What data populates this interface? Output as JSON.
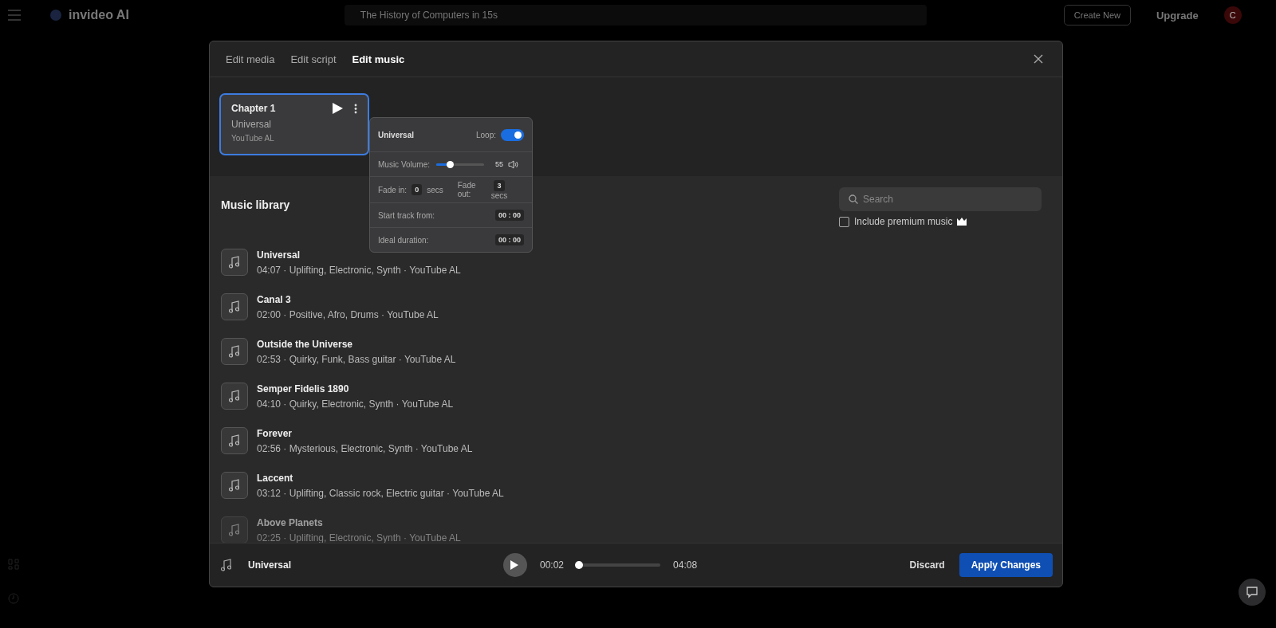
{
  "topbar": {
    "brand": "invideo AI",
    "project_title": "The History of Computers in 15s",
    "create_button": "Create New",
    "upgrade_button": "Upgrade",
    "avatar": "C"
  },
  "modal": {
    "tabs": [
      {
        "label": "Edit media",
        "selected": false
      },
      {
        "label": "Edit script",
        "selected": false
      },
      {
        "label": "Edit music",
        "selected": true
      }
    ],
    "card": {
      "title": "Chapter 1",
      "track": "Universal",
      "source": "YouTube AL",
      "selected": true
    },
    "popover": {
      "track": "Universal",
      "loop_label": "Loop:",
      "loop": true,
      "volume_label": "Music Volume:",
      "volume": {
        "level": 0.3
      },
      "volume_reading": "55",
      "fade_in_label": "Fade in:",
      "fade_in": "0",
      "fade_in_unit": "secs",
      "fade_out_label": "Fade out:",
      "fade_out": "3",
      "fade_out_unit": "secs",
      "start_label": "Start track from:",
      "start": "00 : 00",
      "duration_label": "Ideal duration:",
      "duration": "00 : 00"
    },
    "library": {
      "title": "Music library",
      "search": {
        "placeholder": "Search"
      },
      "premium": {
        "label": "Include premium music",
        "checked": false
      },
      "tracks": [
        {
          "title": "Universal",
          "meta": "04:07 · Uplifting, Electronic, Synth · YouTube AL"
        },
        {
          "title": "Canal 3",
          "meta": "02:00 · Positive, Afro, Drums · YouTube AL"
        },
        {
          "title": "Outside the Universe",
          "meta": "02:53 · Quirky, Funk, Bass guitar · YouTube AL"
        },
        {
          "title": "Semper Fidelis 1890",
          "meta": "04:10 · Quirky, Electronic, Synth · YouTube AL"
        },
        {
          "title": "Forever",
          "meta": "02:56 · Mysterious, Electronic, Synth · YouTube AL"
        },
        {
          "title": "Laccent",
          "meta": "03:12 · Uplifting, Classic rock, Electric guitar · YouTube AL"
        },
        {
          "title": "Above Planets",
          "meta": "02:25 · Uplifting, Electronic, Synth · YouTube AL"
        }
      ]
    },
    "player": {
      "track": "Universal",
      "current": "00:02",
      "total": "04:08",
      "progress": {
        "level": 0.03
      }
    },
    "discard_button": "Discard",
    "apply_button": "Apply Changes"
  }
}
